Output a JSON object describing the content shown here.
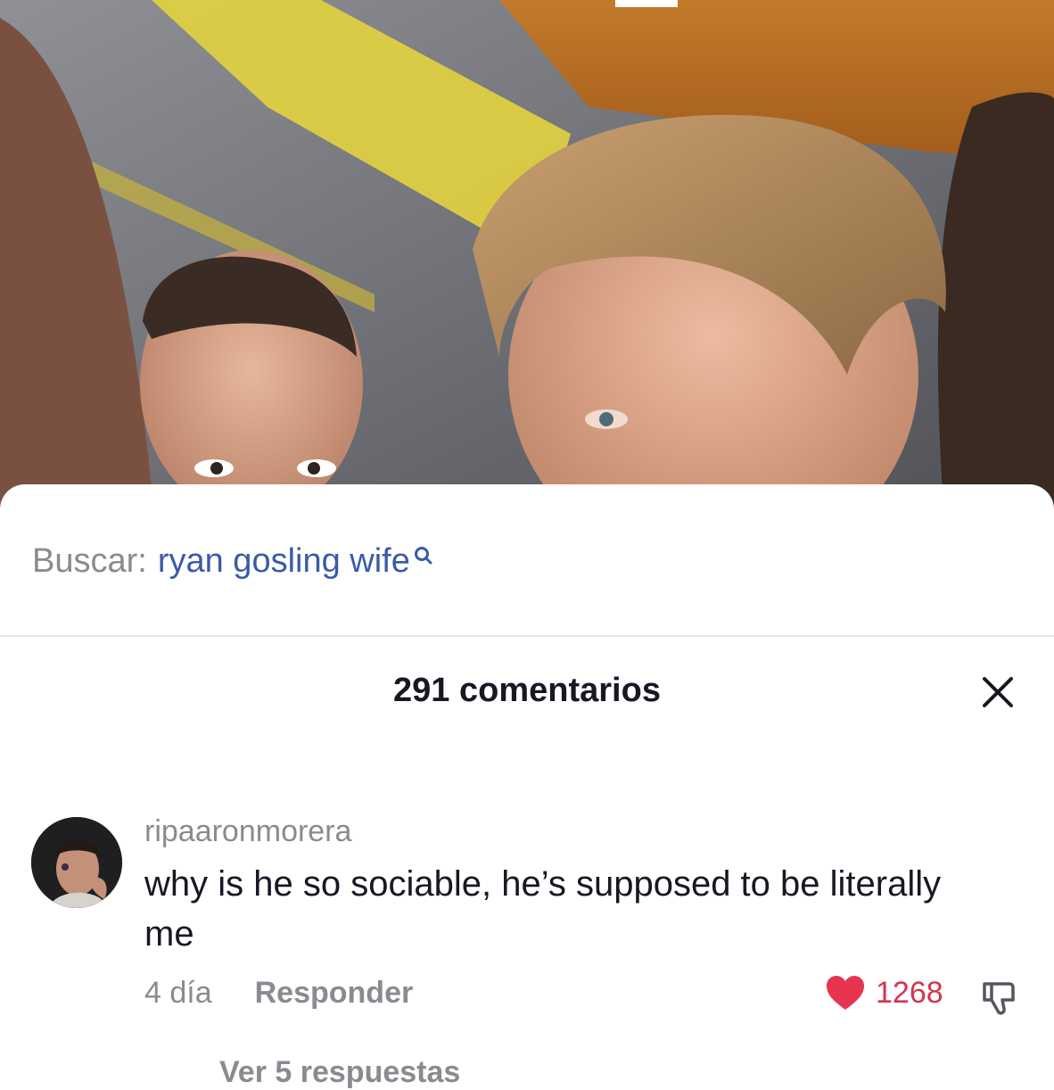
{
  "search": {
    "prefix": "Buscar:",
    "query": "ryan gosling wife",
    "icon": "search-icon"
  },
  "comments_panel": {
    "title": "291 comentarios",
    "close_icon": "close-icon"
  },
  "comment": {
    "username": "ripaaronmorera",
    "text": "why is he so sociable, he’s supposed to be literally me",
    "time": "4 día",
    "reply_label": "Responder",
    "likes": "1268",
    "view_replies": "Ver 5 respuestas"
  },
  "colors": {
    "link_blue": "#3b5ba6",
    "like_red": "#e8354f",
    "muted_gray": "#8a8b91",
    "text_dark": "#161823"
  }
}
